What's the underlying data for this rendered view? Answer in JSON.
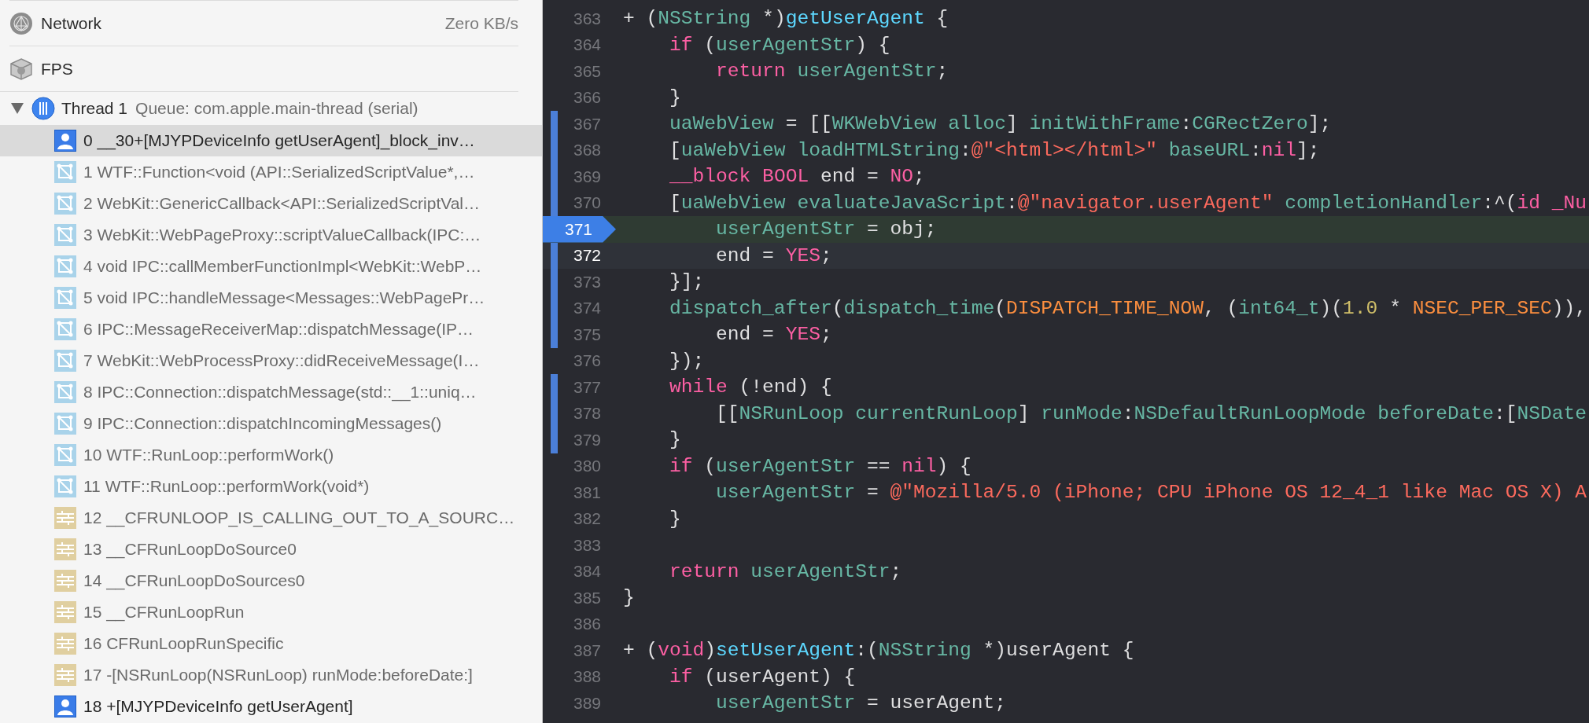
{
  "sidebar": {
    "gauges": [
      {
        "kind": "network",
        "label": "Network",
        "value": "Zero KB/s"
      },
      {
        "kind": "fps",
        "label": "FPS"
      }
    ],
    "thread": {
      "name": "Thread 1",
      "queue": "Queue: com.apple.main-thread (serial)",
      "expanded": true,
      "frames": [
        {
          "kind": "user",
          "label": "0 __30+[MJYPDeviceInfo getUserAgent]_block_inv…",
          "selected": true
        },
        {
          "kind": "framework",
          "label": "1 WTF::Function<void (API::SerializedScriptValue*,…",
          "selected": false
        },
        {
          "kind": "framework",
          "label": "2 WebKit::GenericCallback<API::SerializedScriptVal…",
          "selected": false
        },
        {
          "kind": "framework",
          "label": "3 WebKit::WebPageProxy::scriptValueCallback(IPC:…",
          "selected": false
        },
        {
          "kind": "framework",
          "label": "4 void IPC::callMemberFunctionImpl<WebKit::WebP…",
          "selected": false
        },
        {
          "kind": "framework",
          "label": "5 void IPC::handleMessage<Messages::WebPagePr…",
          "selected": false
        },
        {
          "kind": "framework",
          "label": "6 IPC::MessageReceiverMap::dispatchMessage(IP…",
          "selected": false
        },
        {
          "kind": "framework",
          "label": "7 WebKit::WebProcessProxy::didReceiveMessage(I…",
          "selected": false
        },
        {
          "kind": "framework",
          "label": "8 IPC::Connection::dispatchMessage(std::__1::uniq…",
          "selected": false
        },
        {
          "kind": "framework",
          "label": "9 IPC::Connection::dispatchIncomingMessages()",
          "selected": false
        },
        {
          "kind": "framework",
          "label": "10 WTF::RunLoop::performWork()",
          "selected": false
        },
        {
          "kind": "framework",
          "label": "11 WTF::RunLoop::performWork(void*)",
          "selected": false
        },
        {
          "kind": "system",
          "label": "12 __CFRUNLOOP_IS_CALLING_OUT_TO_A_SOURC…",
          "selected": false
        },
        {
          "kind": "system",
          "label": "13 __CFRunLoopDoSource0",
          "selected": false
        },
        {
          "kind": "system",
          "label": "14 __CFRunLoopDoSources0",
          "selected": false
        },
        {
          "kind": "system",
          "label": "15 __CFRunLoopRun",
          "selected": false
        },
        {
          "kind": "system",
          "label": "16 CFRunLoopRunSpecific",
          "selected": false
        },
        {
          "kind": "system",
          "label": "17 -[NSRunLoop(NSRunLoop) runMode:beforeDate:]",
          "selected": false
        },
        {
          "kind": "user",
          "label": "18 +[MJYPDeviceInfo getUserAgent]",
          "selected": false
        }
      ]
    }
  },
  "editor": {
    "lines": [
      {
        "number": "363",
        "changed": false,
        "breakpoint": false,
        "executing": false,
        "active": false,
        "tokens": [
          {
            "kind": "plain",
            "text": "+ ("
          },
          {
            "kind": "identifier",
            "text": "NSString"
          },
          {
            "kind": "plain",
            "text": " *)"
          },
          {
            "kind": "declaration",
            "text": "getUserAgent"
          },
          {
            "kind": "plain",
            "text": " {"
          }
        ]
      },
      {
        "number": "364",
        "changed": false,
        "breakpoint": false,
        "executing": false,
        "active": false,
        "tokens": [
          {
            "kind": "keyword",
            "text": "    if"
          },
          {
            "kind": "plain",
            "text": " ("
          },
          {
            "kind": "identifier",
            "text": "userAgentStr"
          },
          {
            "kind": "plain",
            "text": ") {"
          }
        ]
      },
      {
        "number": "365",
        "changed": false,
        "breakpoint": false,
        "executing": false,
        "active": false,
        "tokens": [
          {
            "kind": "keyword",
            "text": "        return"
          },
          {
            "kind": "identifier",
            "text": " userAgentStr"
          },
          {
            "kind": "plain",
            "text": ";"
          }
        ]
      },
      {
        "number": "366",
        "changed": false,
        "breakpoint": false,
        "executing": false,
        "active": false,
        "tokens": [
          {
            "kind": "plain",
            "text": "    }"
          }
        ]
      },
      {
        "number": "367",
        "changed": true,
        "breakpoint": false,
        "executing": false,
        "active": false,
        "tokens": [
          {
            "kind": "identifier",
            "text": "    uaWebView"
          },
          {
            "kind": "plain",
            "text": " = [["
          },
          {
            "kind": "identifier",
            "text": "WKWebView"
          },
          {
            "kind": "identifier",
            "text": " alloc"
          },
          {
            "kind": "plain",
            "text": "] "
          },
          {
            "kind": "identifier",
            "text": "initWithFrame"
          },
          {
            "kind": "plain",
            "text": ":"
          },
          {
            "kind": "identifier",
            "text": "CGRectZero"
          },
          {
            "kind": "plain",
            "text": "];"
          }
        ]
      },
      {
        "number": "368",
        "changed": true,
        "breakpoint": false,
        "executing": false,
        "active": false,
        "tokens": [
          {
            "kind": "plain",
            "text": "    ["
          },
          {
            "kind": "identifier",
            "text": "uaWebView"
          },
          {
            "kind": "identifier",
            "text": " loadHTMLString"
          },
          {
            "kind": "plain",
            "text": ":"
          },
          {
            "kind": "string",
            "text": "@\"<html></html>\""
          },
          {
            "kind": "identifier",
            "text": " baseURL"
          },
          {
            "kind": "plain",
            "text": ":"
          },
          {
            "kind": "keyword",
            "text": "nil"
          },
          {
            "kind": "plain",
            "text": "];"
          }
        ]
      },
      {
        "number": "369",
        "changed": true,
        "breakpoint": false,
        "executing": false,
        "active": false,
        "tokens": [
          {
            "kind": "keyword",
            "text": "    __block"
          },
          {
            "kind": "keyword",
            "text": " BOOL"
          },
          {
            "kind": "plain",
            "text": " end = "
          },
          {
            "kind": "keyword",
            "text": "NO"
          },
          {
            "kind": "plain",
            "text": ";"
          }
        ]
      },
      {
        "number": "370",
        "changed": true,
        "breakpoint": false,
        "executing": false,
        "active": false,
        "tokens": [
          {
            "kind": "plain",
            "text": "    ["
          },
          {
            "kind": "identifier",
            "text": "uaWebView"
          },
          {
            "kind": "identifier",
            "text": " evaluateJavaScript"
          },
          {
            "kind": "plain",
            "text": ":"
          },
          {
            "kind": "string",
            "text": "@\"navigator.userAgent\""
          },
          {
            "kind": "identifier",
            "text": " completionHandler"
          },
          {
            "kind": "plain",
            "text": ":^("
          },
          {
            "kind": "keyword",
            "text": "id"
          },
          {
            "kind": "keyword",
            "text": " _Nu"
          }
        ]
      },
      {
        "number": "371",
        "changed": false,
        "breakpoint": true,
        "executing": true,
        "active": false,
        "tokens": [
          {
            "kind": "identifier",
            "text": "        userAgentStr"
          },
          {
            "kind": "plain",
            "text": " = obj;"
          }
        ]
      },
      {
        "number": "372",
        "changed": true,
        "breakpoint": false,
        "executing": false,
        "active": true,
        "tokens": [
          {
            "kind": "plain",
            "text": "        end = "
          },
          {
            "kind": "keyword",
            "text": "YES"
          },
          {
            "kind": "plain",
            "text": ";"
          }
        ]
      },
      {
        "number": "373",
        "changed": true,
        "breakpoint": false,
        "executing": false,
        "active": false,
        "tokens": [
          {
            "kind": "plain",
            "text": "    }];"
          }
        ]
      },
      {
        "number": "374",
        "changed": true,
        "breakpoint": false,
        "executing": false,
        "active": false,
        "tokens": [
          {
            "kind": "identifier",
            "text": "    dispatch_after"
          },
          {
            "kind": "plain",
            "text": "("
          },
          {
            "kind": "identifier",
            "text": "dispatch_time"
          },
          {
            "kind": "plain",
            "text": "("
          },
          {
            "kind": "macro",
            "text": "DISPATCH_TIME_NOW"
          },
          {
            "kind": "plain",
            "text": ", ("
          },
          {
            "kind": "identifier",
            "text": "int64_t"
          },
          {
            "kind": "plain",
            "text": ")("
          },
          {
            "kind": "number",
            "text": "1.0"
          },
          {
            "kind": "plain",
            "text": " * "
          },
          {
            "kind": "macro",
            "text": "NSEC_PER_SEC"
          },
          {
            "kind": "plain",
            "text": ")),"
          }
        ]
      },
      {
        "number": "375",
        "changed": true,
        "breakpoint": false,
        "executing": false,
        "active": false,
        "tokens": [
          {
            "kind": "plain",
            "text": "        end = "
          },
          {
            "kind": "keyword",
            "text": "YES"
          },
          {
            "kind": "plain",
            "text": ";"
          }
        ]
      },
      {
        "number": "376",
        "changed": false,
        "breakpoint": false,
        "executing": false,
        "active": false,
        "tokens": [
          {
            "kind": "plain",
            "text": "    });"
          }
        ]
      },
      {
        "number": "377",
        "changed": true,
        "breakpoint": false,
        "executing": false,
        "active": false,
        "tokens": [
          {
            "kind": "keyword",
            "text": "    while"
          },
          {
            "kind": "plain",
            "text": " (!end) {"
          }
        ]
      },
      {
        "number": "378",
        "changed": true,
        "breakpoint": false,
        "executing": false,
        "active": false,
        "tokens": [
          {
            "kind": "plain",
            "text": "        [["
          },
          {
            "kind": "identifier",
            "text": "NSRunLoop"
          },
          {
            "kind": "identifier",
            "text": " currentRunLoop"
          },
          {
            "kind": "plain",
            "text": "] "
          },
          {
            "kind": "identifier",
            "text": "runMode"
          },
          {
            "kind": "plain",
            "text": ":"
          },
          {
            "kind": "identifier",
            "text": "NSDefaultRunLoopMode"
          },
          {
            "kind": "identifier",
            "text": " beforeDate"
          },
          {
            "kind": "plain",
            "text": ":["
          },
          {
            "kind": "identifier",
            "text": "NSDate"
          }
        ]
      },
      {
        "number": "379",
        "changed": true,
        "breakpoint": false,
        "executing": false,
        "active": false,
        "tokens": [
          {
            "kind": "plain",
            "text": "    }"
          }
        ]
      },
      {
        "number": "380",
        "changed": false,
        "breakpoint": false,
        "executing": false,
        "active": false,
        "tokens": [
          {
            "kind": "keyword",
            "text": "    if"
          },
          {
            "kind": "plain",
            "text": " ("
          },
          {
            "kind": "identifier",
            "text": "userAgentStr"
          },
          {
            "kind": "plain",
            "text": " == "
          },
          {
            "kind": "keyword",
            "text": "nil"
          },
          {
            "kind": "plain",
            "text": ") {"
          }
        ]
      },
      {
        "number": "381",
        "changed": false,
        "breakpoint": false,
        "executing": false,
        "active": false,
        "tokens": [
          {
            "kind": "identifier",
            "text": "        userAgentStr"
          },
          {
            "kind": "plain",
            "text": " = "
          },
          {
            "kind": "string",
            "text": "@\"Mozilla/5.0 (iPhone; CPU iPhone OS 12_4_1 like Mac OS X) A"
          }
        ]
      },
      {
        "number": "382",
        "changed": false,
        "breakpoint": false,
        "executing": false,
        "active": false,
        "tokens": [
          {
            "kind": "plain",
            "text": "    }"
          }
        ]
      },
      {
        "number": "383",
        "changed": false,
        "breakpoint": false,
        "executing": false,
        "active": false
      },
      {
        "number": "384",
        "changed": false,
        "breakpoint": false,
        "executing": false,
        "active": false,
        "tokens": [
          {
            "kind": "keyword",
            "text": "    return"
          },
          {
            "kind": "identifier",
            "text": " userAgentStr"
          },
          {
            "kind": "plain",
            "text": ";"
          }
        ]
      },
      {
        "number": "385",
        "changed": false,
        "breakpoint": false,
        "executing": false,
        "active": false,
        "tokens": [
          {
            "kind": "plain",
            "text": "}"
          }
        ]
      },
      {
        "number": "386",
        "changed": false,
        "breakpoint": false,
        "executing": false,
        "active": false
      },
      {
        "number": "387",
        "changed": false,
        "breakpoint": false,
        "executing": false,
        "active": false,
        "tokens": [
          {
            "kind": "plain",
            "text": "+ ("
          },
          {
            "kind": "keyword",
            "text": "void"
          },
          {
            "kind": "plain",
            "text": ")"
          },
          {
            "kind": "declaration",
            "text": "setUserAgent"
          },
          {
            "kind": "plain",
            "text": ":("
          },
          {
            "kind": "identifier",
            "text": "NSString"
          },
          {
            "kind": "plain",
            "text": " *)userAgent {"
          }
        ]
      },
      {
        "number": "388",
        "changed": false,
        "breakpoint": false,
        "executing": false,
        "active": false,
        "tokens": [
          {
            "kind": "keyword",
            "text": "    if"
          },
          {
            "kind": "plain",
            "text": " (userAgent) {"
          }
        ]
      },
      {
        "number": "389",
        "changed": false,
        "breakpoint": false,
        "executing": false,
        "active": false,
        "tokens": [
          {
            "kind": "identifier",
            "text": "        userAgentStr"
          },
          {
            "kind": "plain",
            "text": " = userAgent;"
          }
        ]
      }
    ]
  }
}
